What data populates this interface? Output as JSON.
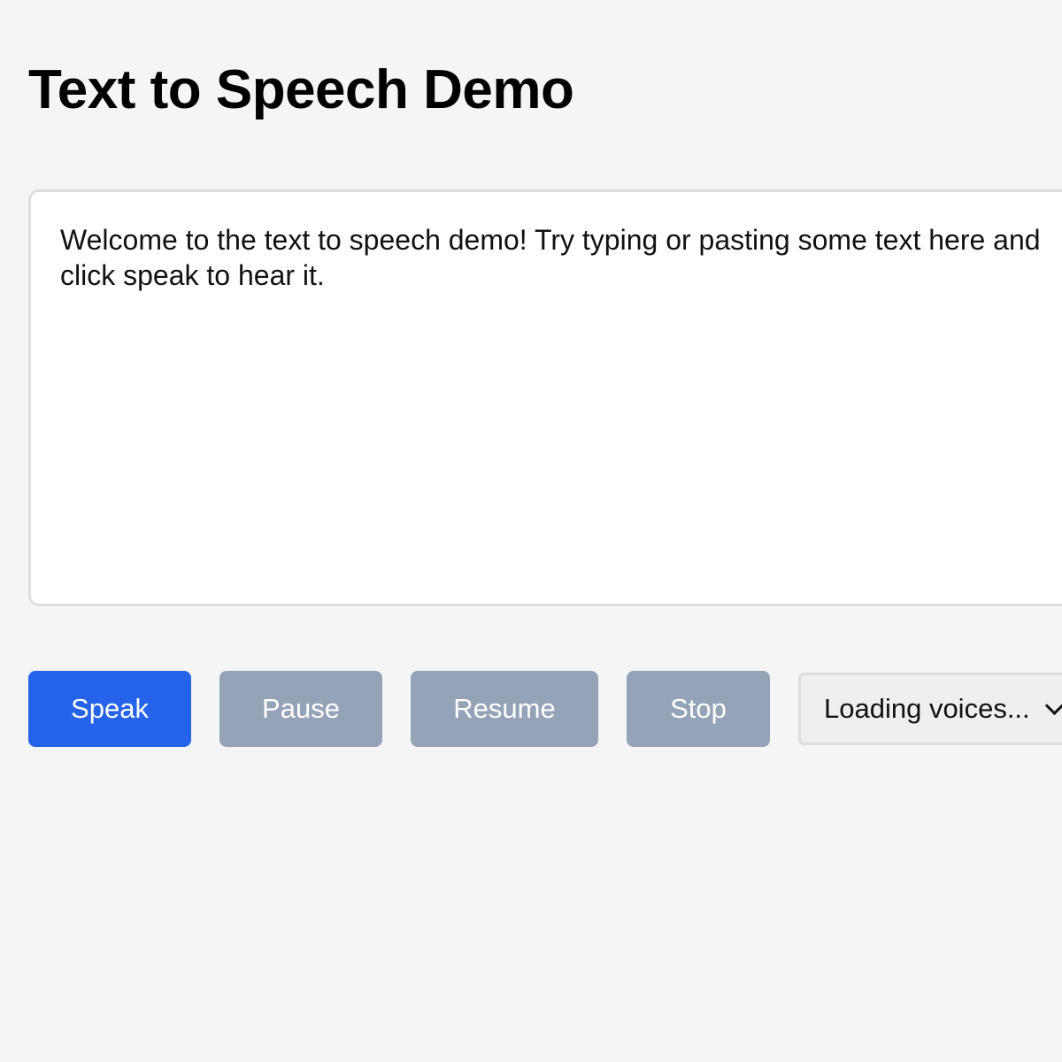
{
  "header": {
    "title": "Text to Speech Demo"
  },
  "editor": {
    "value": "Welcome to the text to speech demo! Try typing or pasting some text here and click speak to hear it."
  },
  "controls": {
    "speak_label": "Speak",
    "pause_label": "Pause",
    "resume_label": "Resume",
    "stop_label": "Stop"
  },
  "voice_select": {
    "selected": "Loading voices...",
    "icon": "chevron-down-icon"
  },
  "colors": {
    "background": "#f5f5f5",
    "primary": "#2563eb",
    "disabled": "#94a3b8",
    "border": "#dddddd"
  }
}
